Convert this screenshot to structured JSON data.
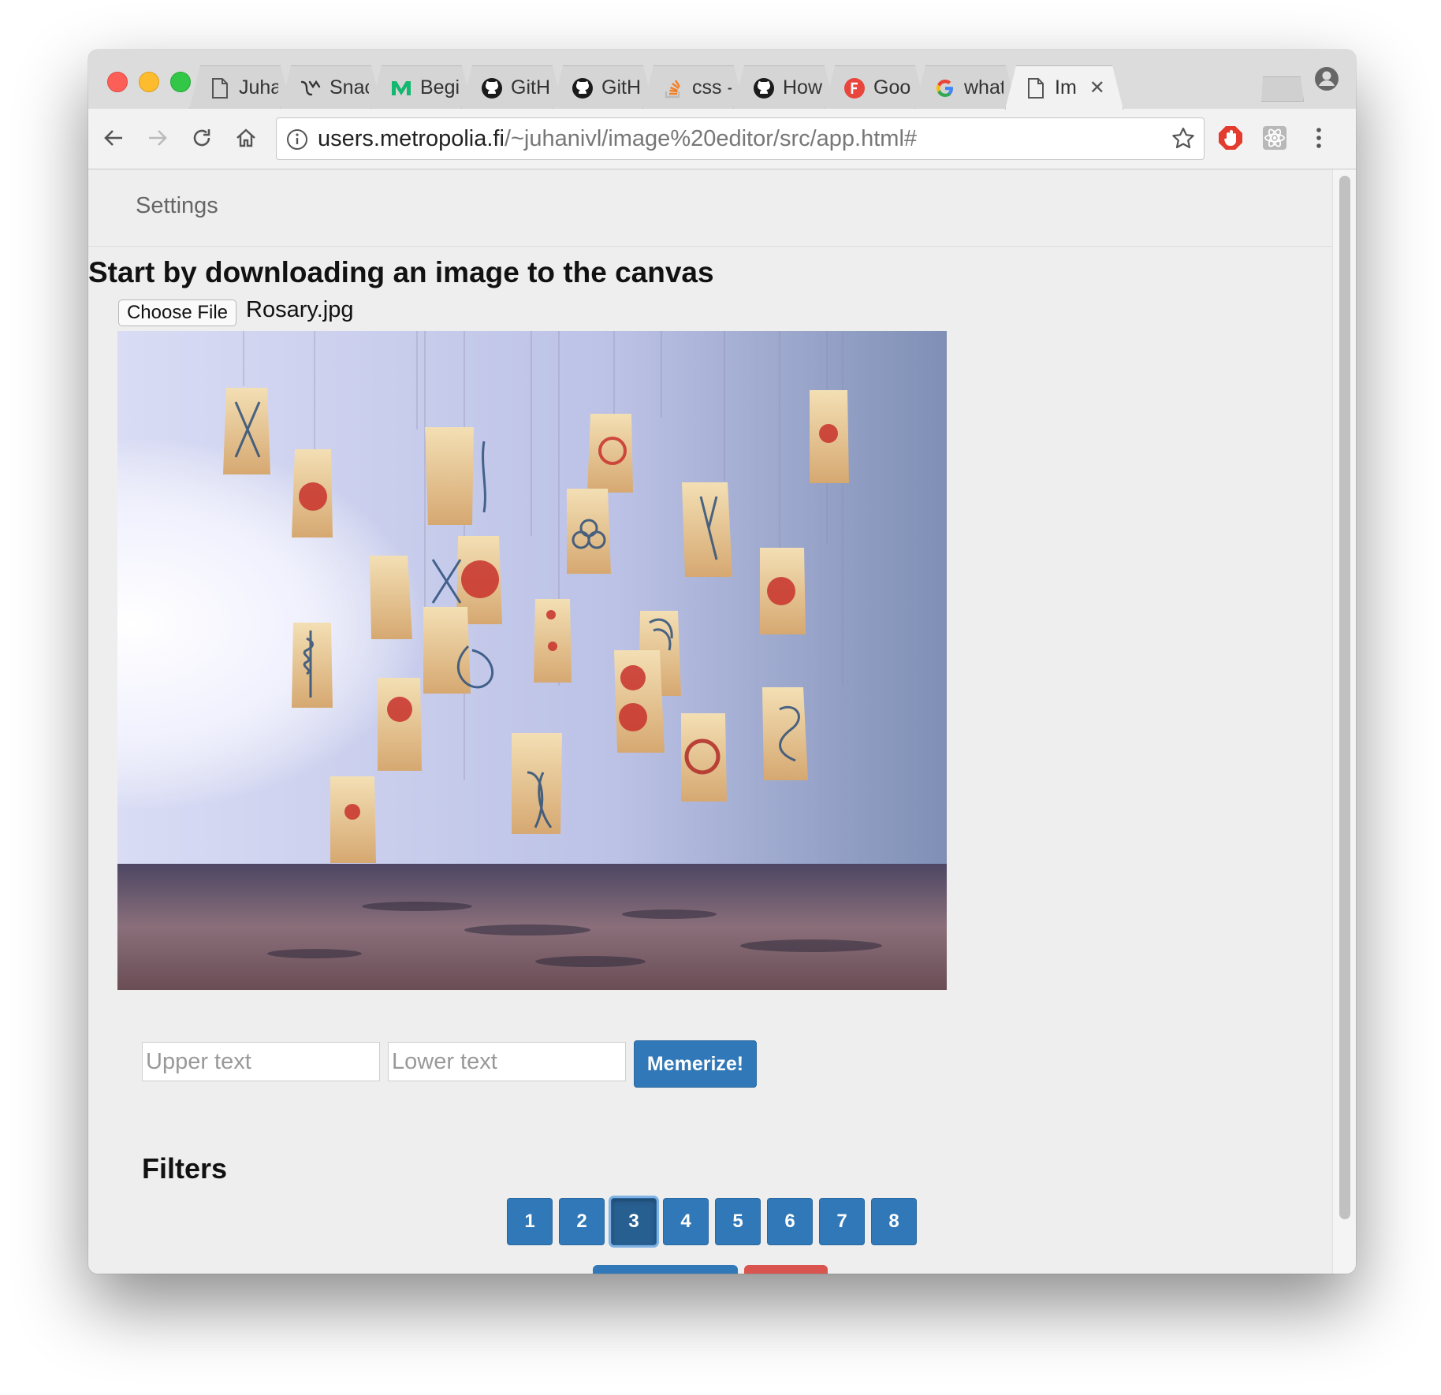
{
  "browser": {
    "tabs": [
      {
        "label": "Juha",
        "icon": "page-icon",
        "active": false
      },
      {
        "label": "Snac",
        "icon": "snack-icon",
        "active": false
      },
      {
        "label": "Begi",
        "icon": "medium-icon",
        "active": false
      },
      {
        "label": "GitH",
        "icon": "github-icon",
        "active": false
      },
      {
        "label": "GitH",
        "icon": "github-icon",
        "active": false
      },
      {
        "label": "css -",
        "icon": "stackoverflow-icon",
        "active": false
      },
      {
        "label": "How",
        "icon": "github-icon",
        "active": false
      },
      {
        "label": "Goo",
        "icon": "firebase-f-icon",
        "active": false
      },
      {
        "label": "what",
        "icon": "google-icon",
        "active": false
      },
      {
        "label": "Im",
        "icon": "page-icon",
        "active": true
      }
    ],
    "address": {
      "host": "users.metropolia.fi",
      "path": "/~juhanivl/image%20editor/src/app.html#"
    }
  },
  "page": {
    "nav": {
      "settings_label": "Settings"
    },
    "heading": "Start by downloading an image to the canvas",
    "file": {
      "button_label": "Choose File",
      "file_name": "Rosary.jpg"
    },
    "meme": {
      "upper_placeholder": "Upper text",
      "lower_placeholder": "Lower text",
      "button_label": "Memerize!"
    },
    "filters": {
      "title": "Filters",
      "buttons": [
        "1",
        "2",
        "3",
        "4",
        "5",
        "6",
        "7",
        "8"
      ],
      "active": "3"
    }
  },
  "colors": {
    "primary": "#3178b8",
    "danger": "#d9534f",
    "page_bg": "#eeeeee"
  }
}
